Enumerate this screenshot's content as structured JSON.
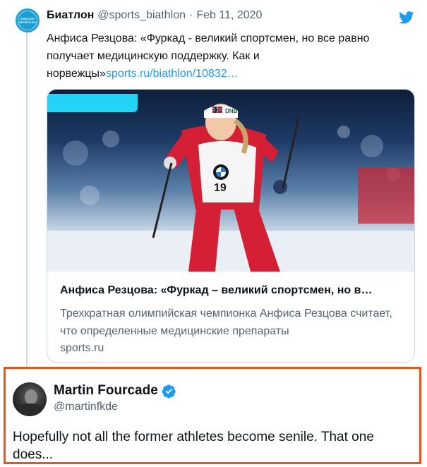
{
  "quoted_tweet": {
    "avatar_label": "БИАТЛОН SPORTS.RU",
    "author_name": "Биатлон",
    "handle": "@sports_biathlon",
    "separator": "·",
    "date": "Feb 11, 2020",
    "text": "Анфиса Резцова: «Фуркад - великий спортсмен, но все равно получает медицинскую поддержку. Как и норвежцы»",
    "link_text": "sports.ru/biathlon/10832…",
    "card": {
      "title": "Анфиса Резцова: «Фуркад – великий спортсмен, но в…",
      "description": "Трехкратная олимпийская чемпионка Анфиса Резцова считает, что определенные медицинские препараты",
      "domain": "sports.ru",
      "bib_number": "19",
      "headband_text": "DNB"
    }
  },
  "reply": {
    "author_name": "Martin Fourcade",
    "handle": "@martinfkde",
    "text": "Hopefully not all the former athletes become senile. That one does..."
  },
  "colors": {
    "link": "#1d9bf0",
    "highlight_border": "#e8541b",
    "verified": "#1d9bf0",
    "redaction": "#22d3f5"
  }
}
